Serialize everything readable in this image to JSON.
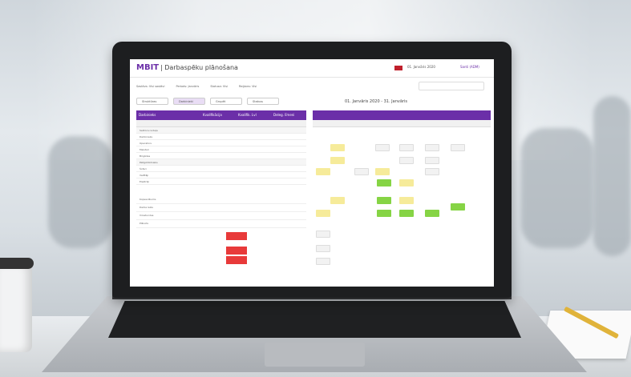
{
  "app": {
    "logo": "MBIT",
    "title": "| Darbaspēku plānošana",
    "date": "01. Janvāris 2020",
    "user": "Santi (ADM)"
  },
  "filters": [
    "Sastāvs: Visi sastāvi",
    "Periods: Janvāris",
    "Statusa: Visi",
    "Reģions: Visi"
  ],
  "toolbar": [
    "Struktūras",
    "Darbinieki",
    "Grupēt",
    "Statuss"
  ],
  "range_label": "01. Janvāris 2020 - 31. Janvāris",
  "left_panel": {
    "header": [
      "Darbinieks",
      "Kvalifikācija",
      "Kvalifik. Lvl",
      "Deleg. līmeni"
    ],
    "rows": [
      "Sektora nodaļa",
      "Darbinieks",
      "Operators",
      "Meistari",
      "Brigādes",
      "Palīgstrādnieks",
      "Šoferi",
      "Vadītāji",
      "Elektriķi"
    ]
  },
  "bottom_table": {
    "rows": [
      "Kopsavilkums",
      "Darba laiks",
      "Virsstundas",
      "Plānots"
    ]
  },
  "colors": {
    "purple": "#6b2fa8",
    "yellow": "#f6eb9a",
    "green": "#86d445",
    "red": "#e83a3a"
  }
}
